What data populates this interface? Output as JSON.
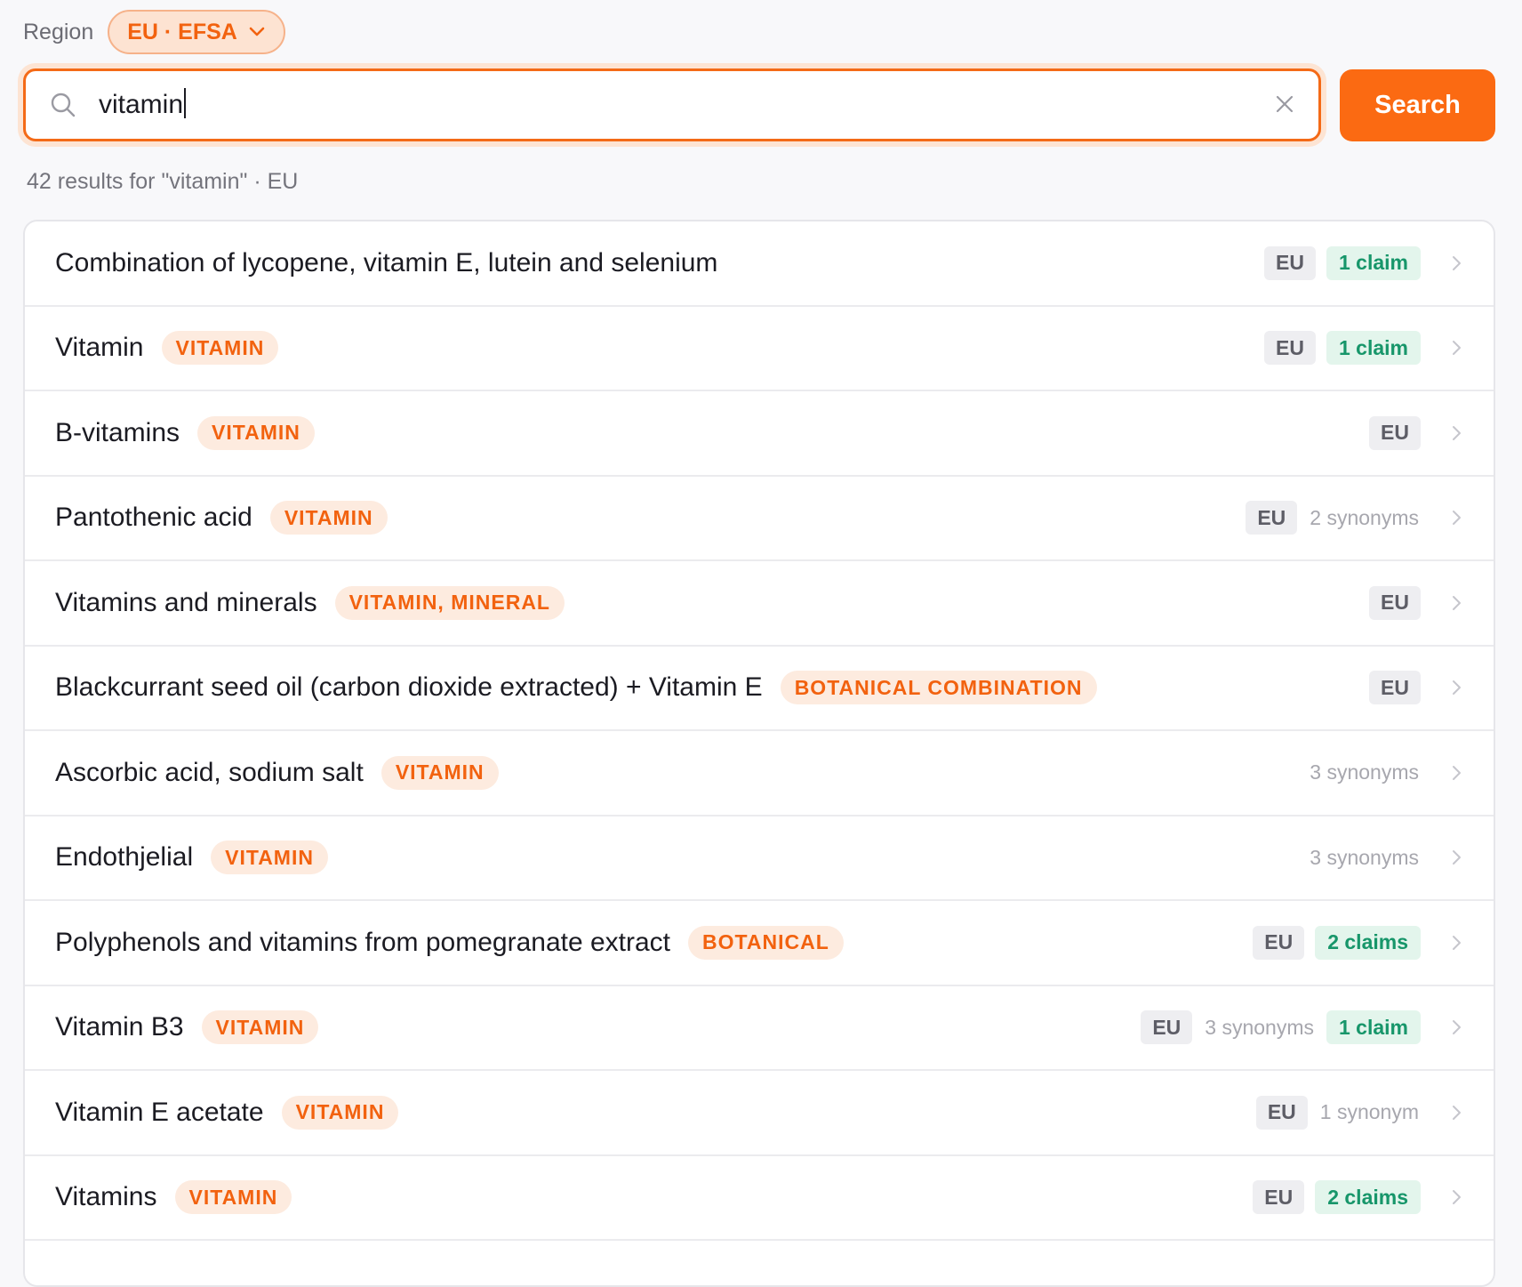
{
  "region": {
    "label": "Region",
    "selected": "EU · EFSA"
  },
  "search": {
    "value": "vitamin",
    "button_label": "Search"
  },
  "results_summary": "42 results for \"vitamin\" · EU",
  "colors": {
    "accent": "#fb6a12",
    "claim_green": "#17966a"
  },
  "results": [
    {
      "name": "Combination of lycopene, vitamin E, lutein and selenium",
      "category": "",
      "region": "EU",
      "synonyms": "",
      "claims": "1 claim"
    },
    {
      "name": "Vitamin",
      "category": "VITAMIN",
      "region": "EU",
      "synonyms": "",
      "claims": "1 claim"
    },
    {
      "name": "B-vitamins",
      "category": "VITAMIN",
      "region": "EU",
      "synonyms": "",
      "claims": ""
    },
    {
      "name": "Pantothenic acid",
      "category": "VITAMIN",
      "region": "EU",
      "synonyms": "2 synonyms",
      "claims": ""
    },
    {
      "name": "Vitamins and minerals",
      "category": "VITAMIN, MINERAL",
      "region": "EU",
      "synonyms": "",
      "claims": ""
    },
    {
      "name": "Blackcurrant seed oil (carbon dioxide extracted) + Vitamin E",
      "category": "BOTANICAL COMBINATION",
      "region": "EU",
      "synonyms": "",
      "claims": ""
    },
    {
      "name": "Ascorbic acid, sodium salt",
      "category": "VITAMIN",
      "region": "",
      "synonyms": "3 synonyms",
      "claims": ""
    },
    {
      "name": "Endothjelial",
      "category": "VITAMIN",
      "region": "",
      "synonyms": "3 synonyms",
      "claims": ""
    },
    {
      "name": "Polyphenols and vitamins from pomegranate extract",
      "category": "BOTANICAL",
      "region": "EU",
      "synonyms": "",
      "claims": "2 claims"
    },
    {
      "name": "Vitamin B3",
      "category": "VITAMIN",
      "region": "EU",
      "synonyms": "3 synonyms",
      "claims": "1 claim"
    },
    {
      "name": "Vitamin E acetate",
      "category": "VITAMIN",
      "region": "EU",
      "synonyms": "1 synonym",
      "claims": ""
    },
    {
      "name": "Vitamins",
      "category": "VITAMIN",
      "region": "EU",
      "synonyms": "",
      "claims": "2 claims"
    }
  ]
}
